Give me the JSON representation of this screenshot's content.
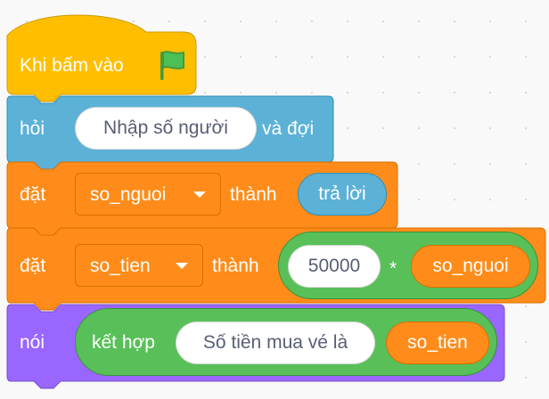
{
  "palette": {
    "events": "#ffbf00",
    "sensing": "#5cb1d6",
    "variables": "#ff8c1a",
    "looks": "#9966ff",
    "operators": "#59c059"
  },
  "script": {
    "hat": {
      "label": "Khi bấm vào",
      "icon": "green-flag-icon"
    },
    "ask": {
      "label": "hỏi",
      "question": "Nhập số người",
      "suffix": "và đợi"
    },
    "set1": {
      "label": "đặt",
      "variable": "so_nguoi",
      "connector": "thành",
      "value": "trả lời"
    },
    "set2": {
      "label": "đặt",
      "variable": "so_tien",
      "connector": "thành",
      "left": "50000",
      "operator": "*",
      "right": "so_nguoi"
    },
    "say": {
      "label": "nói",
      "join": "kết hợp",
      "text": "Số tiền mua vé là",
      "value": "so_tien"
    }
  }
}
